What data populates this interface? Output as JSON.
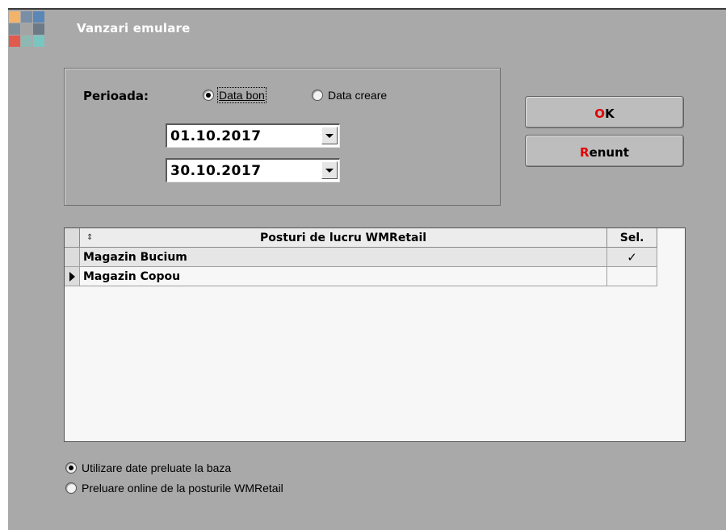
{
  "window": {
    "title": "Vanzari emulare"
  },
  "logo": {
    "colors": [
      "#f2b36b",
      "#7a8ea6",
      "#5b86b8",
      "#7f8f9a",
      "#a4a4a4",
      "#6c7a88",
      "#e05a4e",
      "#8fb8b3",
      "#79c6c1"
    ]
  },
  "period": {
    "label": "Perioada:",
    "options": [
      {
        "label": "Data bon",
        "checked": true
      },
      {
        "label": "Data creare",
        "checked": false
      }
    ],
    "date_from": "01.10.2017",
    "date_to": "30.10.2017"
  },
  "buttons": {
    "ok_hot": "O",
    "ok_rest": "K",
    "cancel_hot": "R",
    "cancel_rest": "enunt"
  },
  "grid": {
    "sort_icon": "⇕",
    "columns": [
      "Posturi de lucru WMRetail",
      "Sel."
    ],
    "rows": [
      {
        "name": "Magazin Bucium",
        "sel": "✓",
        "current": false
      },
      {
        "name": "Magazin Copou",
        "sel": "",
        "current": true
      }
    ]
  },
  "source": {
    "options": [
      {
        "label": "Utilizare date preluate la baza",
        "checked": true
      },
      {
        "label": "Preluare online de la posturile WMRetail",
        "checked": false
      }
    ]
  }
}
